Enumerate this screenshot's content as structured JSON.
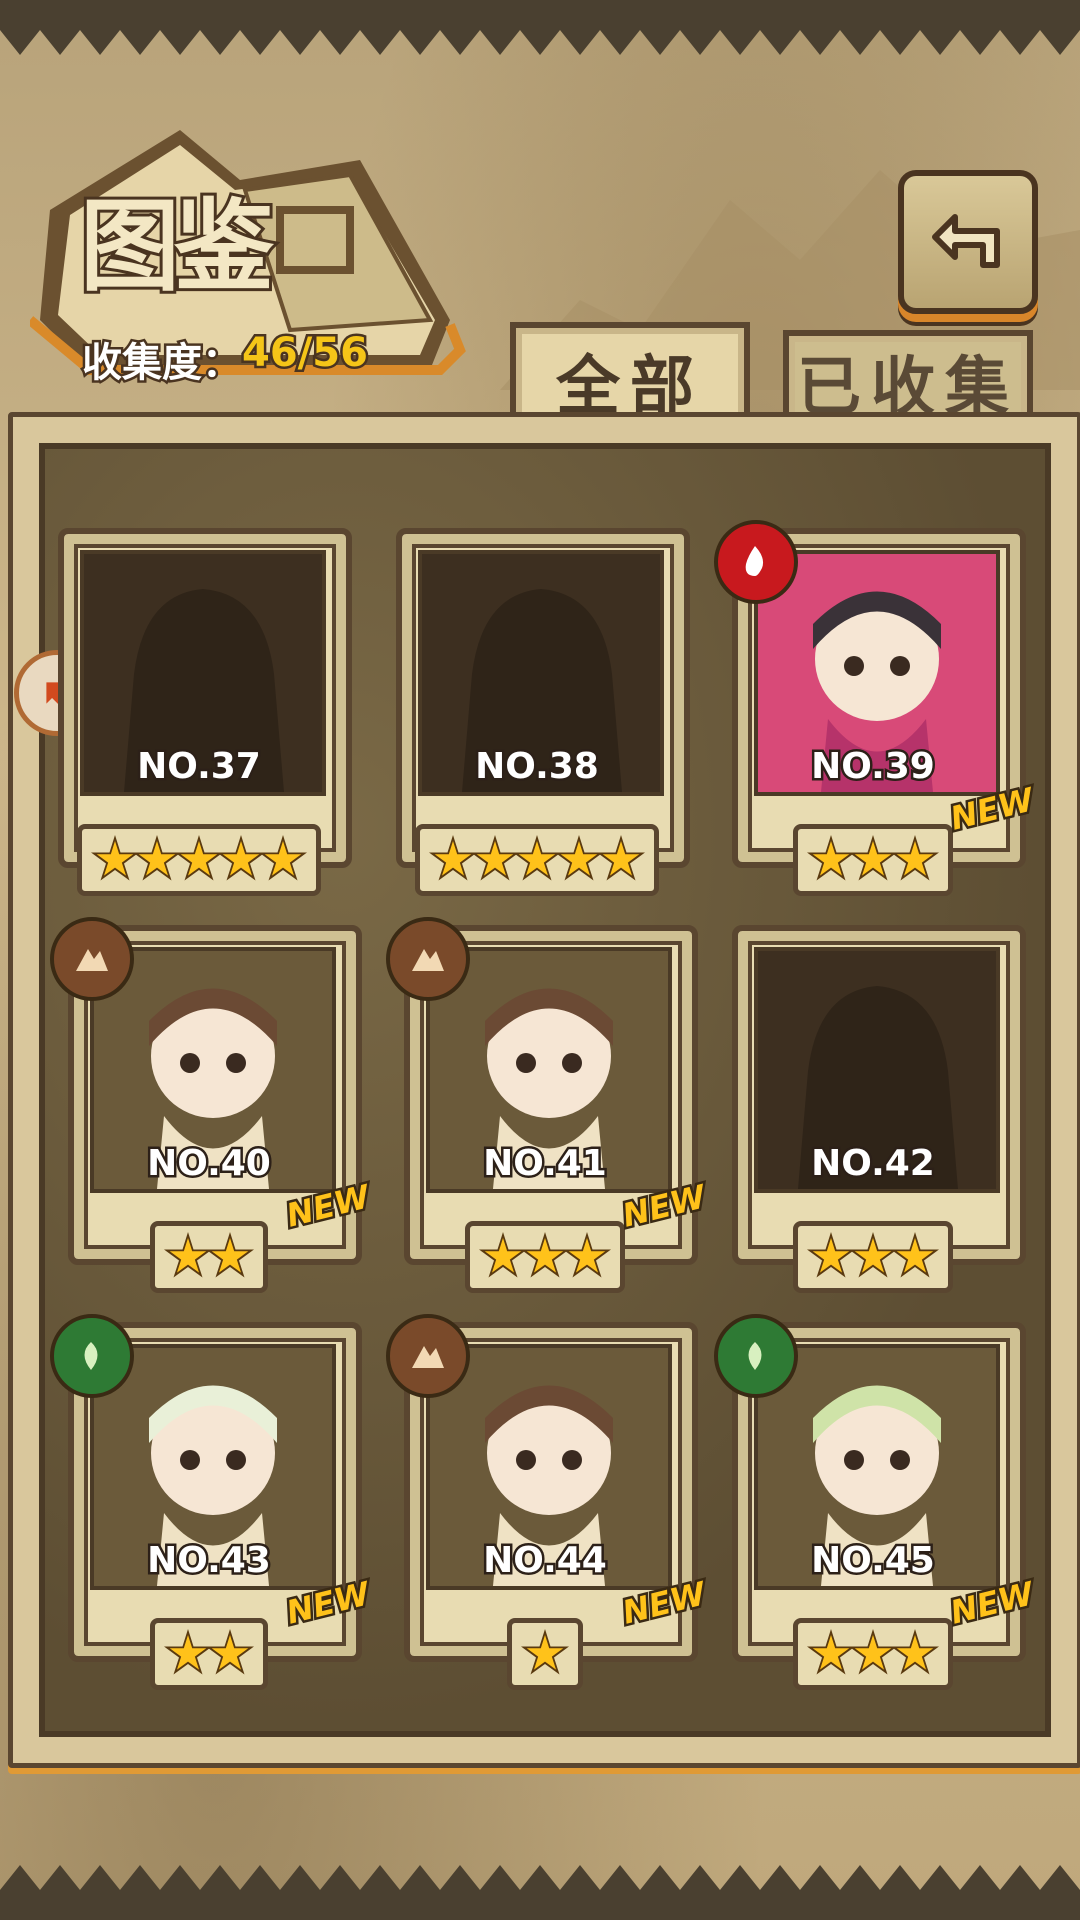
{
  "header": {
    "title": "图鉴",
    "collection_label": "收集度：",
    "collection_value": "46/56"
  },
  "tabs": [
    {
      "label": "全部",
      "selected": true
    },
    {
      "label": "已收集",
      "selected": false
    }
  ],
  "icons": {
    "back": "back-arrow-icon",
    "page_prev": "prev-page-icon",
    "fire": "fire-element-icon",
    "earth": "earth-element-icon",
    "leaf": "leaf-element-icon",
    "star": "star-icon"
  },
  "colors": {
    "star": "#ffc21a",
    "collection_value": "#f5c518",
    "fire": "#c8191e",
    "earth": "#7a4a2a",
    "leaf": "#2e7a34"
  },
  "cards": [
    {
      "no": "NO.37",
      "stars": 5,
      "collected": false,
      "new": false,
      "element": null
    },
    {
      "no": "NO.38",
      "stars": 5,
      "collected": false,
      "new": false,
      "element": null
    },
    {
      "no": "NO.39",
      "stars": 3,
      "collected": true,
      "new": true,
      "new_label": "NEW",
      "element": "fire"
    },
    {
      "no": "NO.40",
      "stars": 2,
      "collected": true,
      "new": true,
      "new_label": "NEW",
      "element": "earth"
    },
    {
      "no": "NO.41",
      "stars": 3,
      "collected": true,
      "new": true,
      "new_label": "NEW",
      "element": "earth"
    },
    {
      "no": "NO.42",
      "stars": 3,
      "collected": false,
      "new": false,
      "element": null
    },
    {
      "no": "NO.43",
      "stars": 2,
      "collected": true,
      "new": true,
      "new_label": "NEW",
      "element": "leaf"
    },
    {
      "no": "NO.44",
      "stars": 1,
      "collected": true,
      "new": true,
      "new_label": "NEW",
      "element": "earth"
    },
    {
      "no": "NO.45",
      "stars": 3,
      "collected": true,
      "new": true,
      "new_label": "NEW",
      "element": "leaf"
    }
  ]
}
